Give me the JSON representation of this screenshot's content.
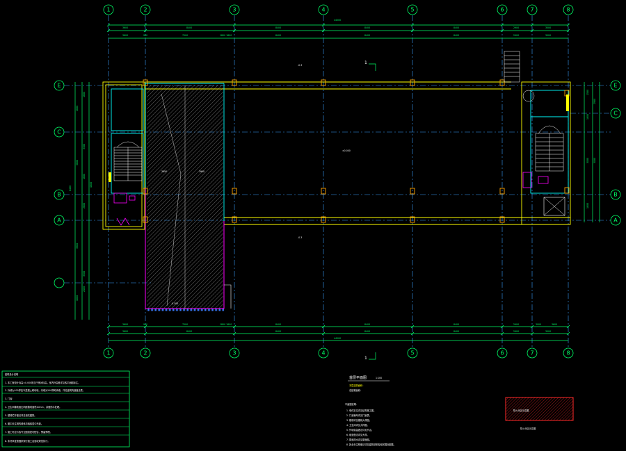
{
  "colors": {
    "background": "#000000",
    "dimension": "#00ff66",
    "grid_axis": "#3aa0ff",
    "wall": "#ffff00",
    "wall_cyan": "#00ffff",
    "ramp": "#ff00ff",
    "text": "#ffffff",
    "stamp": "#ff2a2a"
  },
  "drawing": {
    "column_axes": [
      "1",
      "2",
      "3",
      "4",
      "5",
      "6",
      "7",
      "8"
    ],
    "row_axes": [
      "E",
      "C",
      "B",
      "A",
      "A"
    ],
    "overall_dimension": "44500",
    "top_dims_row1": [
      "3600",
      "8400",
      "8400",
      "8400",
      "8400",
      "2900",
      "3000"
    ],
    "top_dims_row2": [
      "3600",
      "900",
      "7500",
      "1800 1800",
      "8400",
      "8400",
      "8400",
      "2900",
      "3000"
    ],
    "bottom_dims_row1": [
      "3600",
      "900",
      "7500",
      "1800 1800",
      "8400",
      "8400",
      "8400",
      "2900",
      "3000",
      "3600"
    ],
    "bottom_dims_row2": [
      "3600",
      "8400",
      "8400",
      "8400",
      "8400",
      "8400",
      "2900",
      "3000"
    ],
    "left_dims": [
      "1800",
      "1800",
      "3300",
      "1800",
      "5800",
      "4800",
      "2800",
      "8400",
      "3300",
      "2400",
      "1800",
      "3300"
    ],
    "right_dims": [
      "1500",
      "1800",
      "3000",
      "3000",
      "1800",
      "2900"
    ],
    "annotations": {
      "level_top": "-0.3",
      "level_bottom": "-0.3",
      "level_center": "±0.000",
      "axis_mark_top": "1",
      "axis_mark_bottom": "1",
      "ramp_width": "3650",
      "ramp_span": "3900",
      "ramp_bottom": "-0.300"
    }
  },
  "notes_panel": {
    "title": "建筑设计说明",
    "lines": [
      "1. 本工程设计标高±0.000相当于绝对标高，室内外高差详见各平面图标注。",
      "2. 外墙为200厚加气混凝土砌块墙，内墙为200厚砌块墙，详见建筑构造做法表。",
      "3. 门窗：",
      "4. 卫生间楼地面比同层楼地面低20mm，并做防水处理。",
      "5. 楼梯栏杆做法详见相关图集。",
      "6. 图中未注明的墙体均轴线居中布置。",
      "7. 施工时应与各专业图纸密切配合，预留预埋。",
      "8. 未尽事宜按国家现行施工及验收规范执行。"
    ]
  },
  "title_block": {
    "title": "首层平面图",
    "scale": "1:100",
    "sub_lines": [
      "本层建筑面积：",
      "总建筑面积："
    ],
    "notes_header": "平面图说明：",
    "notes": [
      "1. 墙体定位详见结构施工图。",
      "2. 门窗编号详见门窗表。",
      "3. 楼梯详见楼梯大样图。",
      "4. 卫生间详见大样图。",
      "5. 外墙保温做法详见节点。",
      "6. 坡道做法详见大样。",
      "7. 屋面排水详见屋面图。",
      "8. 其余未注明做法详见建筑说明及相关国标图集。"
    ]
  },
  "stamp": {
    "label": "防火分区示意图",
    "caption": "防火分区示意图"
  }
}
